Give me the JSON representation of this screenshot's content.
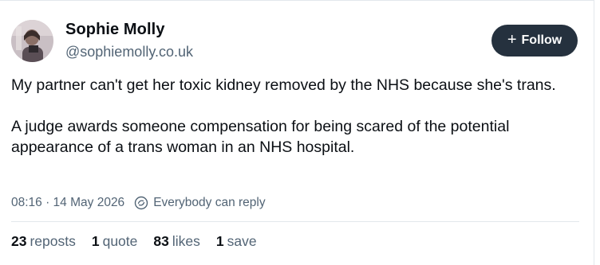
{
  "author": {
    "display_name": "Sophie Molly",
    "handle": "@sophiemolly.co.uk"
  },
  "follow_button": {
    "icon": "+",
    "label": "Follow"
  },
  "post": {
    "paragraphs": [
      "My partner can't get her toxic kidney removed by the NHS because she's trans.",
      "A judge awards someone compensation for being scared of the potential appearance of a trans woman in an NHS hospital."
    ]
  },
  "meta": {
    "timestamp": "08:16 · 14 May 2026",
    "reply_setting": "Everybody can reply"
  },
  "stats": {
    "reposts": {
      "count": "23",
      "label": "reposts"
    },
    "quotes": {
      "count": "1",
      "label": "quote"
    },
    "likes": {
      "count": "83",
      "label": "likes"
    },
    "saves": {
      "count": "1",
      "label": "save"
    }
  },
  "colors": {
    "button_bg": "#25313e",
    "muted_text": "#526475",
    "divider": "#e3e7ec"
  }
}
